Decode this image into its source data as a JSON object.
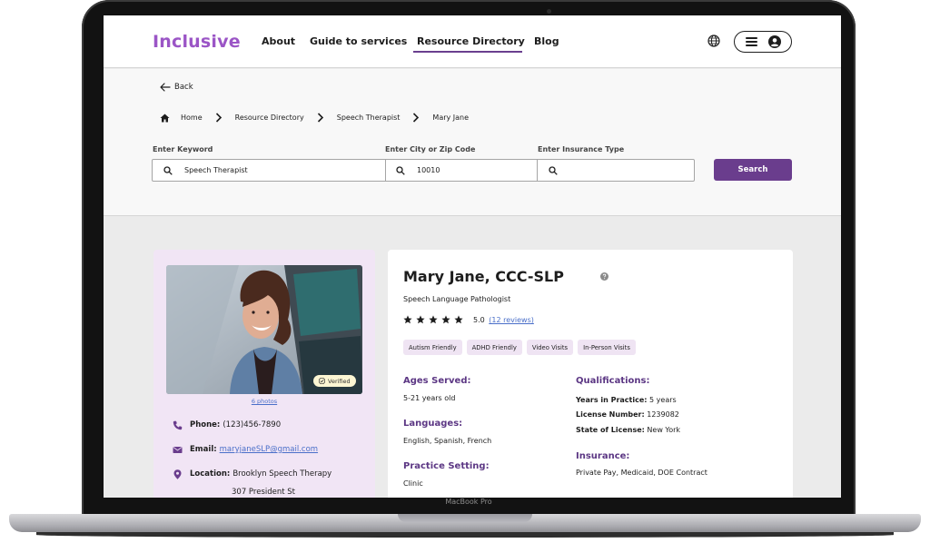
{
  "device": {
    "label": "MacBook Pro"
  },
  "nav": {
    "brand": "Inclusive",
    "links": [
      "About",
      "Guide to services",
      "Resource Directory",
      "Blog"
    ]
  },
  "back_label": "Back",
  "breadcrumb": [
    "Home",
    "Resource Directory",
    "Speech Therapist",
    "Mary Jane"
  ],
  "search": {
    "keyword_label": "Enter Keyword",
    "keyword_value": "Speech Therapist",
    "location_label": "Enter City or Zip Code",
    "location_value": "10010",
    "insurance_label": "Enter Insurance Type",
    "insurance_value": "",
    "button_label": "Search"
  },
  "profile": {
    "verified_label": "Verified",
    "photos_link": "6 photos",
    "phone_label": "Phone:",
    "phone": "(123)456-7890",
    "email_label": "Email:",
    "email": "maryjaneSLP@gmail.com",
    "location_label": "Location:",
    "location_line1": "Brooklyn Speech Therapy",
    "location_line2": "307 President St"
  },
  "details": {
    "name": "Mary Jane, CCC-SLP",
    "title": "Speech Language Pathologist",
    "rating": "5.0",
    "reviews_link": "(12 reviews)",
    "stars": 5,
    "tags": [
      "Autism Friendly",
      "ADHD Friendly",
      "Video Visits",
      "In-Person Visits"
    ],
    "ages_heading": "Ages Served:",
    "ages": "5-21 years old",
    "languages_heading": "Languages:",
    "languages": "English, Spanish, French",
    "setting_heading": "Practice Setting:",
    "setting": "Clinic",
    "qualifications_heading": "Qualifications:",
    "years_label": "Years in Practice:",
    "years_value": "5 years",
    "license_label": "License Number:",
    "license_value": "1239082",
    "state_label": "State of License:",
    "state_value": "New York",
    "insurance_heading": "Insurance:",
    "insurance": "Private Pay, Medicaid, DOE Contract"
  },
  "colors": {
    "brand": "#9b55c6",
    "primary": "#6a3d8d",
    "heading": "#5c3784",
    "card_tint": "#f1e5f5",
    "tag_bg": "#efe4f3",
    "link": "#4a6fc9",
    "verified_bg": "#fcf6d3"
  },
  "icons": [
    "globe-icon",
    "menu-icon",
    "user-icon",
    "arrow-left-icon",
    "home-icon",
    "chevron-right-icon",
    "search-icon",
    "check-icon",
    "phone-icon",
    "email-icon",
    "location-pin-icon",
    "star-icon",
    "help-icon"
  ]
}
